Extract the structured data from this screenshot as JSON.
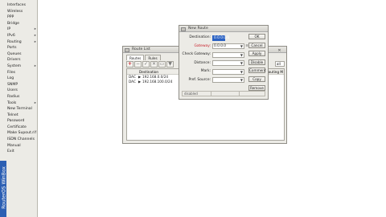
{
  "sidebar": {
    "brand": "RouterOS WinBox",
    "items": [
      {
        "label": "Interfaces",
        "arrow": ""
      },
      {
        "label": "Wireless",
        "arrow": ""
      },
      {
        "label": "PPP",
        "arrow": ""
      },
      {
        "label": "Bridge",
        "arrow": ""
      },
      {
        "label": "IP",
        "arrow": "▸"
      },
      {
        "label": "IPv6",
        "arrow": "▸"
      },
      {
        "label": "Routing",
        "arrow": "▸"
      },
      {
        "label": "Ports",
        "arrow": ""
      },
      {
        "label": "Queues",
        "arrow": ""
      },
      {
        "label": "Drivers",
        "arrow": ""
      },
      {
        "label": "System",
        "arrow": "▸"
      },
      {
        "label": "Files",
        "arrow": ""
      },
      {
        "label": "Log",
        "arrow": ""
      },
      {
        "label": "SNMP",
        "arrow": ""
      },
      {
        "label": "Users",
        "arrow": ""
      },
      {
        "label": "Radius",
        "arrow": ""
      },
      {
        "label": "Tools",
        "arrow": "▸"
      },
      {
        "label": "New Terminal",
        "arrow": ""
      },
      {
        "label": "Telnet",
        "arrow": ""
      },
      {
        "label": "Password",
        "arrow": ""
      },
      {
        "label": "Certificate",
        "arrow": ""
      },
      {
        "label": "Make Supout.rif",
        "arrow": ""
      },
      {
        "label": "ISDN Channels",
        "arrow": ""
      },
      {
        "label": "Manual",
        "arrow": ""
      },
      {
        "label": "Exit",
        "arrow": ""
      }
    ]
  },
  "route_list": {
    "title": "Route List",
    "tabs": [
      "Routes",
      "Rules"
    ],
    "toolbar": {
      "add": "+",
      "filter": "all"
    },
    "columns": {
      "flags": "",
      "destination": "Destination",
      "routing_mark": "Routing M"
    },
    "rows": [
      {
        "flags": "DAC",
        "destination": "192.168.0.0/24"
      },
      {
        "flags": "DAC",
        "destination": "192.168.100.0/24"
      }
    ]
  },
  "new_route": {
    "title": "New Route",
    "fields": {
      "destination": {
        "label": "Destination:",
        "value": "0.0.0.0/0"
      },
      "gateway": {
        "label": "Gateway:",
        "value": "0.0.0.0"
      },
      "check_gateway": {
        "label": "Check Gateway:",
        "value": ""
      },
      "distance": {
        "label": "Distance:",
        "value": ""
      },
      "mark": {
        "label": "Mark:",
        "value": ""
      },
      "pref_source": {
        "label": "Pref. Source:",
        "value": ""
      }
    },
    "buttons": {
      "ok": "OK",
      "cancel": "Cancel",
      "apply": "Apply",
      "disable": "Disable",
      "comment": "Comment",
      "copy": "Copy",
      "remove": "Remove"
    },
    "status": "disabled"
  }
}
